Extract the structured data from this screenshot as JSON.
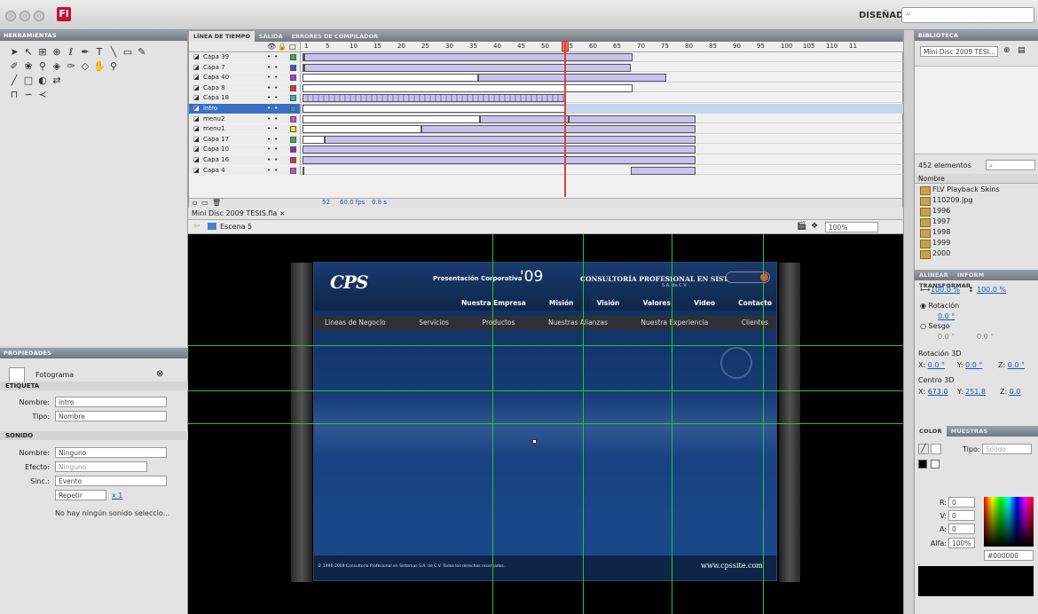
{
  "workspace": "DISEÑADOR ▾",
  "tools_panel": {
    "title": "HERRAMIENTAS"
  },
  "properties": {
    "title": "PROPIEDADES",
    "type_label": "Fotograma",
    "etiqueta_header": "ETIQUETA",
    "nombre_label": "Nombre:",
    "nombre_value": "intro",
    "tipo_label": "Tipo:",
    "tipo_value": "Nombre",
    "sonido_header": "SONIDO",
    "sonido_nombre_label": "Nombre:",
    "sonido_nombre_value": "Ninguno",
    "efecto_label": "Efecto:",
    "efecto_value": "Ninguno",
    "sinc_label": "Sinc.:",
    "sinc_value": "Evento",
    "repetir_value": "Repetir",
    "repeat_count": "x 1",
    "no_sound_text": "No hay ningún sonido seleccio..."
  },
  "timeline": {
    "tabs": [
      "LÍNEA DE TIEMPO",
      "SALIDA",
      "ERRORES DE COMPILADOR"
    ],
    "frame_numbers": [
      "1",
      "5",
      "10",
      "15",
      "20",
      "25",
      "30",
      "35",
      "40",
      "45",
      "50",
      "55",
      "60",
      "65",
      "70",
      "75",
      "80",
      "85",
      "90",
      "95",
      "100",
      "105",
      "110",
      "11"
    ],
    "current_frame": 52,
    "layers": [
      {
        "name": "Capa 39",
        "color": "#3ab24a"
      },
      {
        "name": "Capa 7",
        "color": "#3b58d9"
      },
      {
        "name": "Capa 40",
        "color": "#a23ad9"
      },
      {
        "name": "Capa 8",
        "color": "#e0303a"
      },
      {
        "name": "Capa 18",
        "color": "#2fb7c8"
      },
      {
        "name": "intro",
        "color": "#2a8af0",
        "selected": true
      },
      {
        "name": "menu2",
        "color": "#e04ad0"
      },
      {
        "name": "menu1",
        "color": "#f2e33a"
      },
      {
        "name": "Capa 17",
        "color": "#3ab24a"
      },
      {
        "name": "Capa 10",
        "color": "#8a2ad9"
      },
      {
        "name": "Capa 16",
        "color": "#e0303a"
      },
      {
        "name": "Capa 4",
        "color": "#d04ad9"
      }
    ],
    "status": {
      "frame": "52",
      "fps": "60.0 fps",
      "time": "0.8 s"
    }
  },
  "document": {
    "tab": "Mini Disc 2009 TESIS.fla ×",
    "scene": "Escena 5",
    "zoom": "100%"
  },
  "site": {
    "logo": "CPS",
    "presentation": "Presentación Corporativa",
    "year": "'09",
    "company": "CONSULTORÍA PROFESIONAL EN SISTEMAS",
    "company_sub": "S.A. de C.V.",
    "nav_top": [
      "Nuestra Empresa",
      "Misión",
      "Visión",
      "Valores",
      "Video",
      "Contacto"
    ],
    "nav_bottom": [
      "Lineas de Negocio",
      "Servicios",
      "Productos",
      "Nuestras Alianzas",
      "Nuestra Experiencia",
      "Clientes"
    ],
    "footer_copy": "© 1996-2009 Consultoría Profesional en Sistemas S.A. de C.V. Todos los derechos reservados.",
    "footer_url": "www.cpssite.com"
  },
  "library": {
    "tabs": [
      "BIBLIOTECA"
    ],
    "selector": "Mini Disc 2009 TESI...",
    "count": "452 elementos",
    "column": "Nombre",
    "items": [
      "FLV Playback Skins",
      "110209.jpg",
      "1996",
      "1997",
      "1998",
      "1999",
      "2000"
    ]
  },
  "transform": {
    "tabs": [
      "ALINEAR",
      "INFORM",
      "TRANSFORMAR"
    ],
    "scale_w": "100.0 %",
    "scale_h": "100.0 %",
    "rotacion_label": "Rotación",
    "rotacion_value": "0.0 °",
    "sesgo_label": "Sesgo",
    "sesgo_h": "0.0 °",
    "sesgo_v": "0.0 °",
    "rot3d_label": "Rotación 3D",
    "rot3d": {
      "x": "0.0 °",
      "y": "0.0 °",
      "z": "0.0 °"
    },
    "centro3d_label": "Centro 3D",
    "centro3d": {
      "x": "673.0",
      "y": "251.8",
      "z": "0.0"
    }
  },
  "color_panel": {
    "tabs": [
      "COLOR",
      "MUESTRAS"
    ],
    "tipo_label": "Tipo:",
    "tipo_value": "Sólido",
    "r_label": "R:",
    "r": "0",
    "v_label": "V:",
    "v": "0",
    "a_label": "A:",
    "a": "0",
    "alfa_label": "Alfa:",
    "alfa": "100%",
    "hex": "#000000"
  }
}
